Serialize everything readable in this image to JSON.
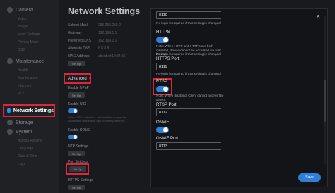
{
  "sidebar": {
    "sections": [
      {
        "label": "Camera",
        "subs": [
          "Video",
          "Image",
          "Mask Settings",
          "Privacy Mask",
          "OSD"
        ]
      },
      {
        "label": "Maintenance",
        "subs": [
          "Health",
          "Maintenance",
          "Intercom",
          "PTZ"
        ]
      },
      {
        "label": "Network Settings",
        "subs": []
      },
      {
        "label": "Storage",
        "subs": []
      },
      {
        "label": "System",
        "subs": [
          "Access Record",
          "Language",
          "Date & Time",
          "Logs"
        ]
      }
    ]
  },
  "main": {
    "title": "Network Settings",
    "fields": [
      {
        "label": "Subnet Mask",
        "value": "255.255.255.0"
      },
      {
        "label": "Gateway",
        "value": "192.168.1.1"
      },
      {
        "label": "Preferred DNS",
        "value": "192.168.1.1"
      },
      {
        "label": "Alternate DNS",
        "value": "8.8.8.8"
      },
      {
        "label": "MAC Address",
        "value": "ab:cd:ef:12:34:56"
      }
    ],
    "setup_label": "Set Up",
    "advanced_label": "Advanced",
    "enable_upnp": "Enable UPnP",
    "enable_uid": "Enable UID",
    "uid_hint": "When UID is disabled, device will no longer be accessible via Reolink app or client platforms.",
    "enable_ddns": "Enable DDNS",
    "ntp_label": "NTP Settings",
    "port_label": "Port Settings",
    "https_label": "HTTPS Settings"
  },
  "modal": {
    "close": "×",
    "top_port": "8110",
    "relogin_note": "Re-login is required if that setting is changed.",
    "https_label": "HTTPS",
    "https_note": "Note: When HTTP and HTTPS are both disabled, device cannot be accessed via web browser.",
    "https_relogin": "Re-login is required if that setting is changed.",
    "https_port_label": "HTTPS Port",
    "https_port": "8111",
    "rtsp_label": "RTSP",
    "rtsp_note": "Note: When disabled, Client cannot access the device.",
    "rtsp_port_label": "RTSP Port",
    "rtsp_port": "8112",
    "onvif_label": "ONVIF",
    "onvif_port_label": "ONVIF Port",
    "onvif_port": "8113",
    "save_label": "Save"
  },
  "colors": {
    "accent": "#2f7fd8",
    "highlight": "#e0243b",
    "background": "#181a1d"
  }
}
